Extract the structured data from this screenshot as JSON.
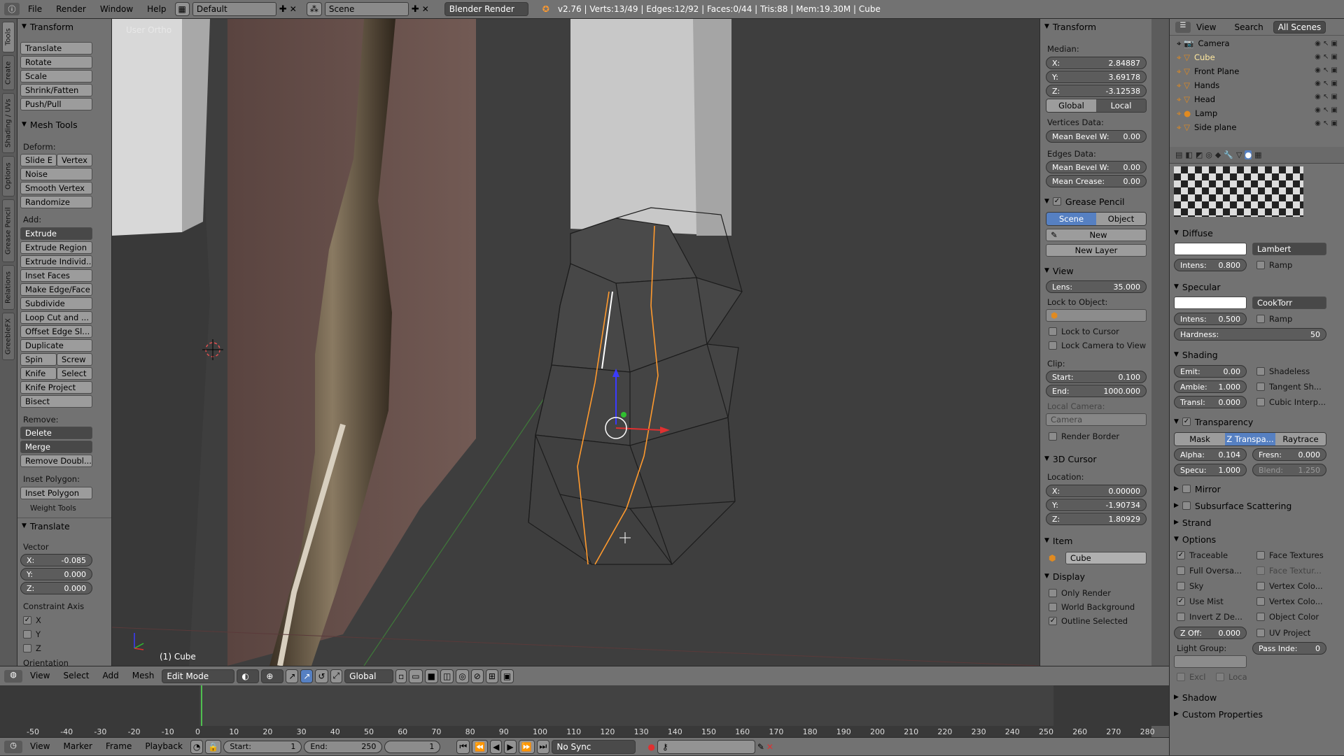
{
  "topbar": {
    "menus": [
      "File",
      "Render",
      "Window",
      "Help"
    ],
    "layout": "Default",
    "scene": "Scene",
    "engine": "Blender Render",
    "stats": "v2.76 | Verts:13/49 | Edges:12/92 | Faces:0/44 | Tris:88 | Mem:19.30M | Cube"
  },
  "left_tabs": [
    "Tools",
    "Create",
    "Shading / UVs",
    "Options",
    "Grease Pencil",
    "Relations",
    "GreebleFX"
  ],
  "toolshelf": {
    "transform_title": "Transform",
    "transform_buttons": [
      "Translate",
      "Rotate",
      "Scale",
      "Shrink/Fatten",
      "Push/Pull"
    ],
    "mesh_tools_title": "Mesh Tools",
    "deform_label": "Deform:",
    "slide_e": "Slide E",
    "vertex": "Vertex",
    "noise": "Noise",
    "smooth_vertex": "Smooth Vertex",
    "randomize": "Randomize",
    "add_label": "Add:",
    "extrude": "Extrude",
    "extrude_region": "Extrude Region",
    "extrude_individual": "Extrude Individ...",
    "inset_faces": "Inset Faces",
    "make_edge_face": "Make Edge/Face",
    "subdivide": "Subdivide",
    "loop_cut": "Loop Cut and ...",
    "offset_edge": "Offset Edge Sl...",
    "duplicate": "Duplicate",
    "spin": "Spin",
    "screw": "Screw",
    "knife": "Knife",
    "select": "Select",
    "knife_project": "Knife Project",
    "bisect": "Bisect",
    "remove_label": "Remove:",
    "delete": "Delete",
    "merge": "Merge",
    "remove_doubles": "Remove Doubl...",
    "inset_polygon_label": "Inset Polygon:",
    "inset_polygon": "Inset Polygon",
    "weight_tools": "Weight Tools",
    "op_title": "Translate",
    "vector_label": "Vector",
    "vx_label": "X:",
    "vx": "-0.085",
    "vy_label": "Y:",
    "vy": "0.000",
    "vz_label": "Z:",
    "vz": "0.000",
    "constraint_label": "Constraint Axis",
    "cx": "X",
    "cy": "Y",
    "cz": "Z",
    "orientation": "Orientation"
  },
  "viewport": {
    "view_label": "User Ortho",
    "object_label": "(1) Cube"
  },
  "npanel": {
    "transform": "Transform",
    "median": "Median:",
    "x_label": "X:",
    "x": "2.84887",
    "y_label": "Y:",
    "y": "3.69178",
    "z_label": "Z:",
    "z": "-3.12538",
    "global": "Global",
    "local": "Local",
    "vertices_data": "Vertices Data:",
    "mean_bevel_w": "Mean Bevel W:",
    "mean_bevel_w_val": "0.00",
    "edges_data": "Edges Data:",
    "mean_bevel_w2": "Mean Bevel W:",
    "mean_bevel_w2_val": "0.00",
    "mean_crease": "Mean Crease:",
    "mean_crease_val": "0.00",
    "grease_pencil": "Grease Pencil",
    "gp_scene": "Scene",
    "gp_object": "Object",
    "gp_new": "New",
    "gp_new_layer": "New Layer",
    "view": "View",
    "lens_label": "Lens:",
    "lens": "35.000",
    "lock_to_object": "Lock to Object:",
    "lock_to_cursor": "Lock to Cursor",
    "lock_camera": "Lock Camera to View",
    "clip": "Clip:",
    "start_label": "Start:",
    "start": "0.100",
    "end_label": "End:",
    "end": "1000.000",
    "local_camera": "Local Camera:",
    "camera": "Camera",
    "render_border": "Render Border",
    "cursor3d": "3D Cursor",
    "location": "Location:",
    "cx_label": "X:",
    "cx": "0.00000",
    "cy_label": "Y:",
    "cy": "-1.90734",
    "cz_label": "Z:",
    "cz": "1.80929",
    "item": "Item",
    "item_name": "Cube",
    "display": "Display",
    "only_render": "Only Render",
    "world_background": "World Background",
    "outline_selected": "Outline Selected"
  },
  "outliner": {
    "view": "View",
    "search": "Search",
    "scenes": "All Scenes",
    "items": [
      "Camera",
      "Cube",
      "Front Plane",
      "Hands",
      "Head",
      "Lamp",
      "Side plane"
    ]
  },
  "props": {
    "diffuse": "Diffuse",
    "lambert": "Lambert",
    "intens_label": "Intens:",
    "intens": "0.800",
    "ramp": "Ramp",
    "specular": "Specular",
    "cooktorr": "CookTorr",
    "spec_intens_label": "Intens:",
    "spec_intens": "0.500",
    "spec_ramp": "Ramp",
    "hardness_label": "Hardness:",
    "hardness": "50",
    "shading": "Shading",
    "emit_label": "Emit:",
    "emit": "0.00",
    "shadeless": "Shadeless",
    "ambi_label": "Ambie:",
    "ambi": "1.000",
    "tangent": "Tangent Sh...",
    "transl_label": "Transl:",
    "transl": "0.000",
    "cubic": "Cubic Interp...",
    "transparency": "Transparency",
    "mask": "Mask",
    "ztransp": "Z Transpa...",
    "raytrace": "Raytrace",
    "alpha_label": "Alpha:",
    "alpha": "0.104",
    "fresn_label": "Fresn:",
    "fresn": "0.000",
    "specu_label": "Specu:",
    "specu": "1.000",
    "blend_label": "Blend:",
    "blend": "1.250",
    "mirror": "Mirror",
    "sss": "Subsurface Scattering",
    "strand": "Strand",
    "options": "Options",
    "traceable": "Traceable",
    "face_textures": "Face Textures",
    "full_oversa": "Full Oversa...",
    "face_textur": "Face Textur...",
    "sky": "Sky",
    "vertex_colo1": "Vertex Colo...",
    "use_mist": "Use Mist",
    "vertex_colo2": "Vertex Colo...",
    "invert_z": "Invert Z De...",
    "object_color": "Object Color",
    "zoff_label": "Z Off:",
    "zoff": "0.000",
    "uv_project": "UV Project",
    "light_group": "Light Group:",
    "pass_index_label": "Pass Inde:",
    "pass_index": "0",
    "excl": "Excl",
    "loca": "Loca",
    "shadow": "Shadow",
    "custom_props": "Custom Properties"
  },
  "vphead": {
    "menus": [
      "View",
      "Select",
      "Add",
      "Mesh"
    ],
    "mode": "Edit Mode",
    "orientation": "Global"
  },
  "timeline": {
    "ticks": [
      "-50",
      "-40",
      "-30",
      "-20",
      "-10",
      "0",
      "10",
      "20",
      "30",
      "40",
      "50",
      "60",
      "70",
      "80",
      "90",
      "100",
      "110",
      "120",
      "130",
      "140",
      "150",
      "160",
      "170",
      "180",
      "190",
      "200",
      "210",
      "220",
      "230",
      "240",
      "250",
      "260",
      "270",
      "280"
    ],
    "menus": [
      "View",
      "Marker",
      "Frame",
      "Playback"
    ],
    "start_label": "Start:",
    "start": "1",
    "end_label": "End:",
    "end": "250",
    "current": "1",
    "sync": "No Sync"
  },
  "colors": {
    "accent": "#5680c2",
    "edge_selected": "#ff9a2e",
    "background": "#3e3e3e"
  }
}
